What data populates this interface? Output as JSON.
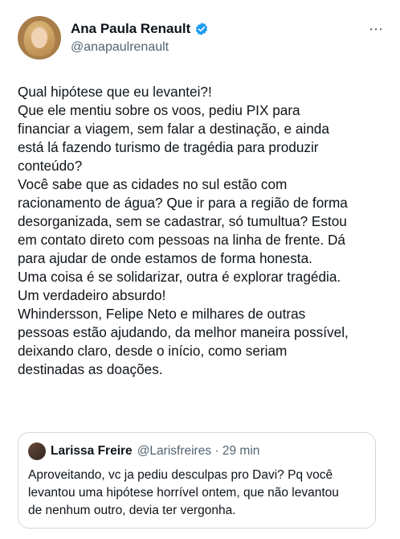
{
  "post": {
    "author_name": "Ana Paula Renault",
    "author_handle": "@anapaulrenault",
    "more_icon": "⋯",
    "lines": [
      "Qual hipótese que eu levantei?!",
      "Que ele mentiu sobre os voos, pediu PIX para",
      "financiar a viagem, sem falar a destinação, e ainda",
      "está lá fazendo turismo de tragédia para produzir",
      "conteúdo?",
      "Você sabe que as cidades no sul estão com",
      "racionamento de água? Que ir para a região de forma",
      "desorganizada, sem se cadastrar, só tumultua? Estou",
      "em contato direto com pessoas na linha de frente. Dá",
      "para ajudar de onde estamos de forma honesta.",
      "Uma coisa é se solidarizar, outra é explorar tragédia.",
      "Um verdadeiro absurdo!",
      "Whindersson, Felipe Neto e milhares de outras",
      "pessoas estão ajudando, da melhor maneira possível,",
      "deixando claro, desde o início, como seriam",
      "destinadas as doações."
    ]
  },
  "quote": {
    "author_name": "Larissa Freire",
    "author_handle_time": "@Larisfreires · 29 min",
    "lines": [
      "Aproveitando, vc ja pediu desculpas pro Davi? Pq você",
      "levantou uma hipótese horrível ontem, que não levantou",
      "de nenhum outro, devia ter vergonha."
    ]
  },
  "colors": {
    "text": "#0f1419",
    "secondary": "#536471",
    "verified": "#1d9bf0",
    "border": "#cfd9de"
  },
  "icons": {
    "verified": "verified-badge-icon",
    "more": "more-options-icon"
  }
}
